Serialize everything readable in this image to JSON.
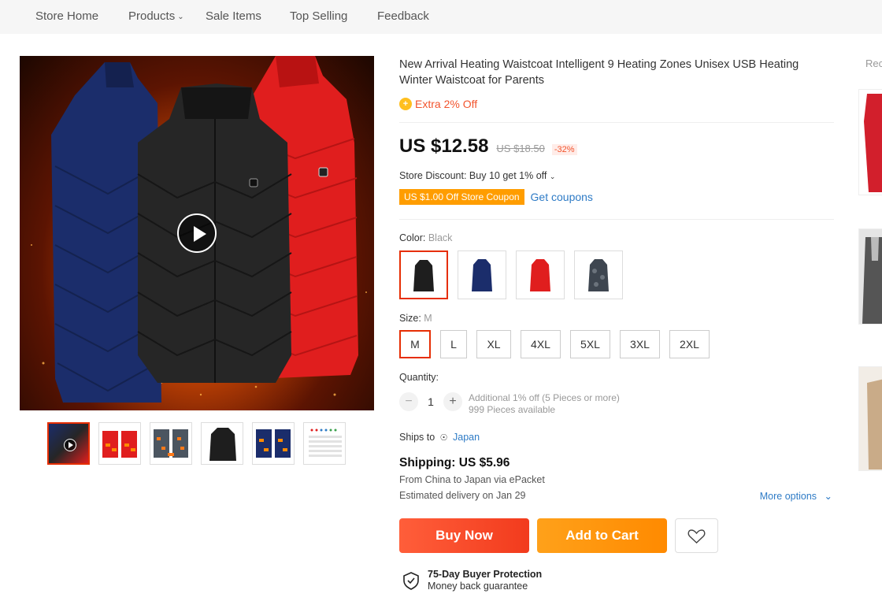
{
  "nav": {
    "items": [
      "Store Home",
      "Products",
      "Sale Items",
      "Top Selling",
      "Feedback"
    ]
  },
  "product": {
    "title": "New Arrival Heating Waistcoat Intelligent 9 Heating Zones Unisex USB Heating Winter Waistcoat for Parents",
    "extra_off": "Extra 2% Off",
    "price": "US $12.58",
    "original_price": "US $18.50",
    "discount": "-32%",
    "store_discount": "Store Discount: Buy 10 get 1% off",
    "coupon": "US $1.00 Off Store Coupon",
    "get_coupons": "Get coupons"
  },
  "color": {
    "label": "Color:",
    "selected": "Black",
    "options": [
      "black",
      "navy",
      "red",
      "camo"
    ]
  },
  "size": {
    "label": "Size:",
    "selected": "M",
    "options": [
      "M",
      "L",
      "XL",
      "4XL",
      "5XL",
      "3XL",
      "2XL"
    ]
  },
  "quantity": {
    "label": "Quantity:",
    "value": "1",
    "additional": "Additional 1% off (5 Pieces or more)",
    "available": "999 Pieces available"
  },
  "shipping": {
    "ships_to_label": "Ships to",
    "ships_to": "Japan",
    "price": "Shipping: US $5.96",
    "from": "From China to Japan via ePacket",
    "delivery": "Estimated delivery on Jan 29",
    "more_options": "More options"
  },
  "actions": {
    "buy_now": "Buy Now",
    "add_to_cart": "Add to Cart"
  },
  "protection": {
    "title": "75-Day Buyer Protection",
    "subtitle": "Money back guarantee"
  },
  "recommended": {
    "title": "Rec"
  },
  "colors": {
    "accent": "#e62e04",
    "buy": "#f23b1d",
    "cart": "#ff9000",
    "link": "#2e7bc6",
    "coupon": "#ff9d00"
  }
}
